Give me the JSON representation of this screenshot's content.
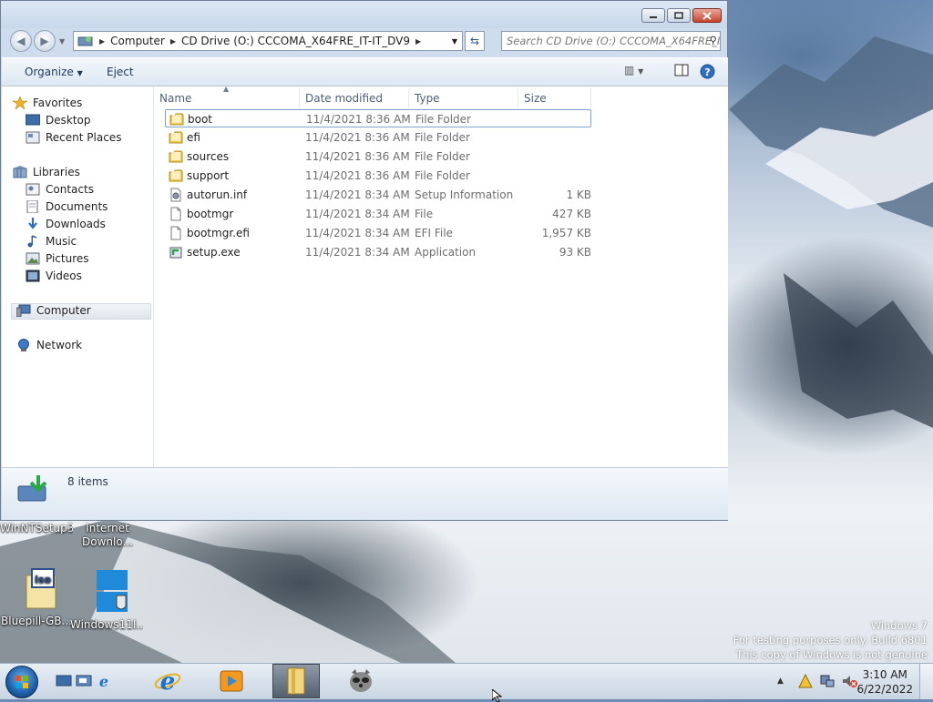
{
  "window": {
    "address": {
      "segments": [
        "Computer",
        "CD Drive (O:) CCCOMA_X64FRE_IT-IT_DV9"
      ]
    },
    "search_placeholder": "Search CD Drive (O:) CCCOMA_X64FRE_I",
    "toolbar": {
      "organize": "Organize",
      "eject": "Eject"
    },
    "nav": {
      "favorites": "Favorites",
      "desktop": "Desktop",
      "recent_places": "Recent Places",
      "libraries": "Libraries",
      "contacts": "Contacts",
      "documents": "Documents",
      "downloads": "Downloads",
      "music": "Music",
      "pictures": "Pictures",
      "videos": "Videos",
      "computer": "Computer",
      "network": "Network"
    },
    "columns": {
      "name": "Name",
      "date": "Date modified",
      "type": "Type",
      "size": "Size"
    },
    "files": [
      {
        "name": "boot",
        "date": "11/4/2021 8:36 AM",
        "type": "File Folder",
        "size": "",
        "icon": "folder-icon"
      },
      {
        "name": "efi",
        "date": "11/4/2021 8:36 AM",
        "type": "File Folder",
        "size": "",
        "icon": "folder-icon"
      },
      {
        "name": "sources",
        "date": "11/4/2021 8:36 AM",
        "type": "File Folder",
        "size": "",
        "icon": "folder-icon"
      },
      {
        "name": "support",
        "date": "11/4/2021 8:36 AM",
        "type": "File Folder",
        "size": "",
        "icon": "folder-icon"
      },
      {
        "name": "autorun.inf",
        "date": "11/4/2021 8:34 AM",
        "type": "Setup Information",
        "size": "1 KB",
        "icon": "settings-file-icon"
      },
      {
        "name": "bootmgr",
        "date": "11/4/2021 8:34 AM",
        "type": "File",
        "size": "427 KB",
        "icon": "file-icon"
      },
      {
        "name": "bootmgr.efi",
        "date": "11/4/2021 8:34 AM",
        "type": "EFI File",
        "size": "1,957 KB",
        "icon": "file-icon"
      },
      {
        "name": "setup.exe",
        "date": "11/4/2021 8:34 AM",
        "type": "Application",
        "size": "93 KB",
        "icon": "setup-icon"
      }
    ],
    "details": {
      "item_count": "8 items"
    }
  },
  "desktop": {
    "icons": [
      {
        "label": "WinNTSetup3"
      },
      {
        "label": "Internet Downlo..."
      },
      {
        "label": "Bluepill-GB..."
      },
      {
        "label": "Windows11I..."
      }
    ],
    "watermark": {
      "line1": "Windows 7",
      "line2": "For testing purposes only. Build 6801",
      "line3": "This copy of Windows is not genuine"
    }
  },
  "taskbar": {
    "clock_time": "3:10 AM",
    "clock_date": "6/22/2022"
  },
  "colors": {
    "taskbar": "#c9d5e2",
    "window_frame": "#cfdced",
    "selection_border": "#7da2ce"
  }
}
